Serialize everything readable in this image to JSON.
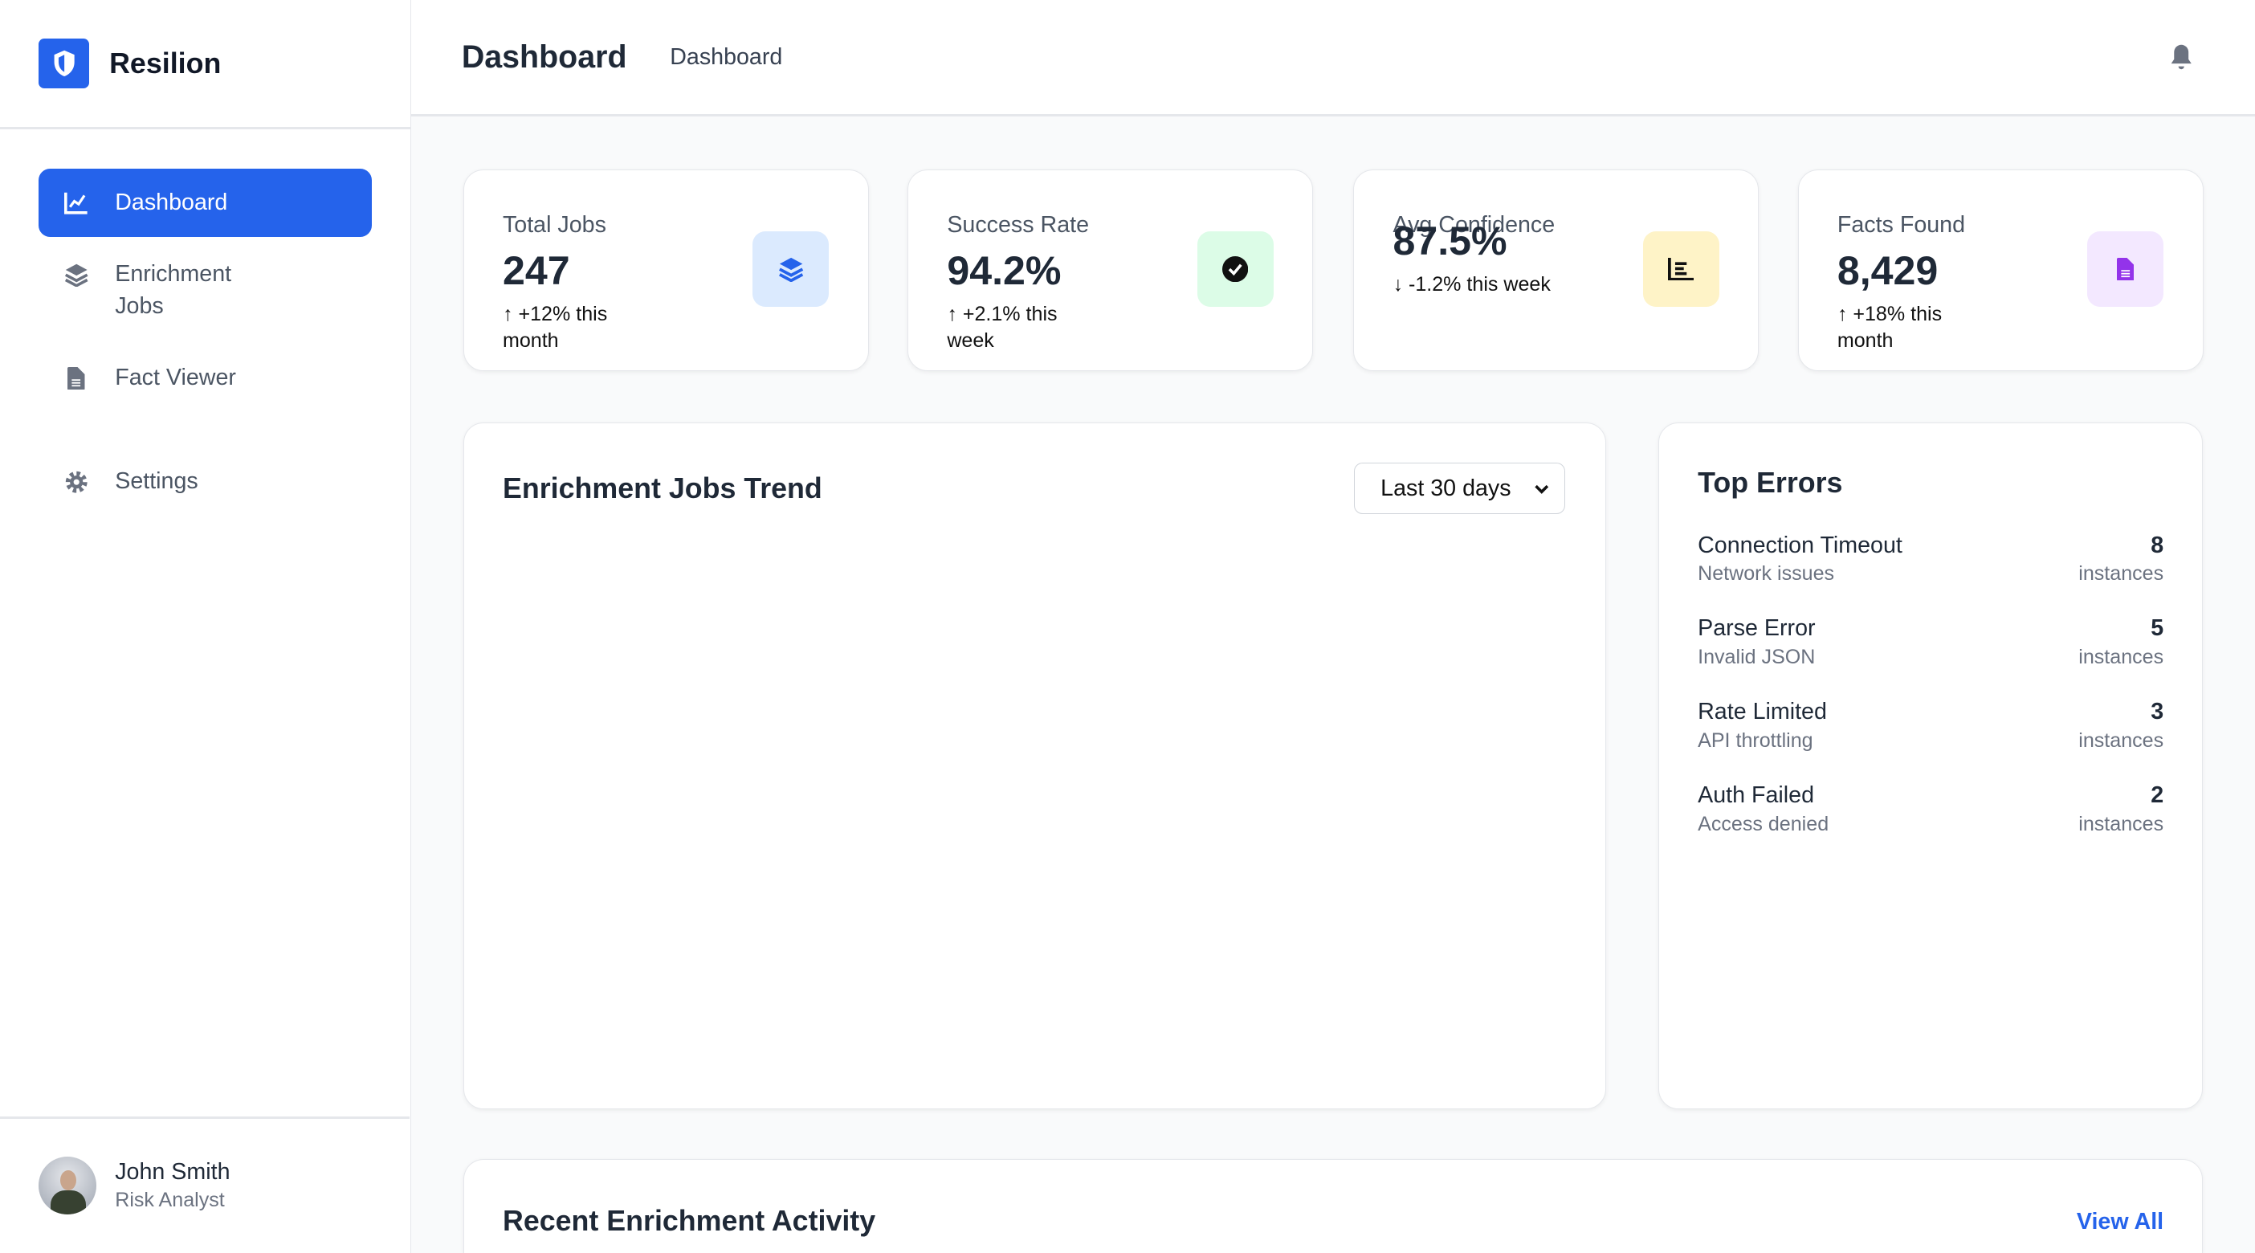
{
  "brand": {
    "name": "Resilion"
  },
  "nav": [
    {
      "label": "Dashboard"
    },
    {
      "label": "Enrichment Jobs"
    },
    {
      "label": "Fact Viewer"
    },
    {
      "label": "Settings"
    }
  ],
  "user": {
    "name": "John Smith",
    "role": "Risk Analyst"
  },
  "header": {
    "title": "Dashboard",
    "breadcrumb": "Dashboard"
  },
  "stats": [
    {
      "label": "Total Jobs",
      "value": "247",
      "change": "+12% this month",
      "direction": "up",
      "color": "#2563eb",
      "bg": "#dbeafe"
    },
    {
      "label": "Success Rate",
      "value": "94.2%",
      "change": "+2.1% this week",
      "direction": "up",
      "color": "#111827",
      "bg": "#dcfce7"
    },
    {
      "label": "Avg Confidence",
      "value": "87.5%",
      "change": "-1.2% this week",
      "direction": "down",
      "color": "#111827",
      "bg": "#fef3c7"
    },
    {
      "label": "Facts Found",
      "value": "8,429",
      "change": "+18% this month",
      "direction": "up",
      "color": "#9333ea",
      "bg": "#f3e8ff"
    }
  ],
  "trend": {
    "title": "Enrichment Jobs Trend",
    "range": "Last 30 days"
  },
  "errors": {
    "title": "Top Errors",
    "unit": "instances",
    "items": [
      {
        "name": "Connection Timeout",
        "desc": "Network issues",
        "count": "8"
      },
      {
        "name": "Parse Error",
        "desc": "Invalid JSON",
        "count": "5"
      },
      {
        "name": "Rate Limited",
        "desc": "API throttling",
        "count": "3"
      },
      {
        "name": "Auth Failed",
        "desc": "Access denied",
        "count": "2"
      }
    ]
  },
  "recent": {
    "title": "Recent Enrichment Activity",
    "view_all": "View All"
  }
}
